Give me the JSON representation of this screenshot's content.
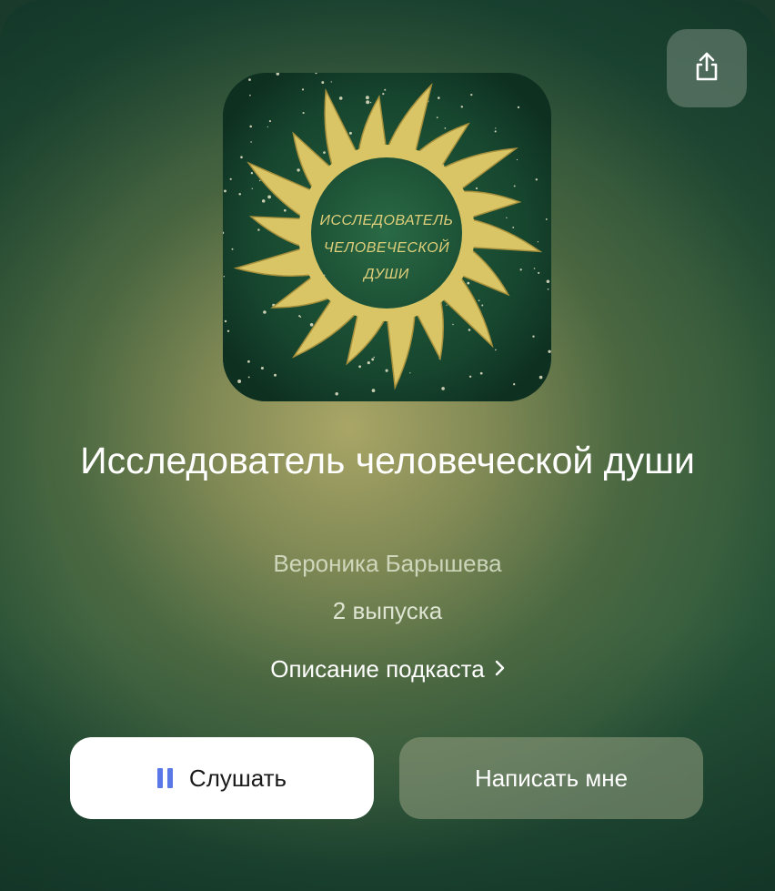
{
  "colors": {
    "accent": "#5b79e6",
    "primary_button_bg": "#ffffff",
    "cover_gold": "#d8c36a",
    "cover_green": "#1f5a3d"
  },
  "header": {
    "share_icon": "share-icon"
  },
  "cover": {
    "text_line1": "ИССЛЕДОВАТЕЛЬ",
    "text_line2": "ЧЕЛОВЕЧЕСКОЙ",
    "text_line3": "ДУШИ"
  },
  "podcast": {
    "title": "Исследователь человеческой души",
    "author": "Вероника Барышева",
    "episodes": "2 выпуска",
    "description_link": "Описание подкаста"
  },
  "actions": {
    "listen_label": "Слушать",
    "listen_icon": "pause-icon",
    "write_label": "Написать мне"
  }
}
